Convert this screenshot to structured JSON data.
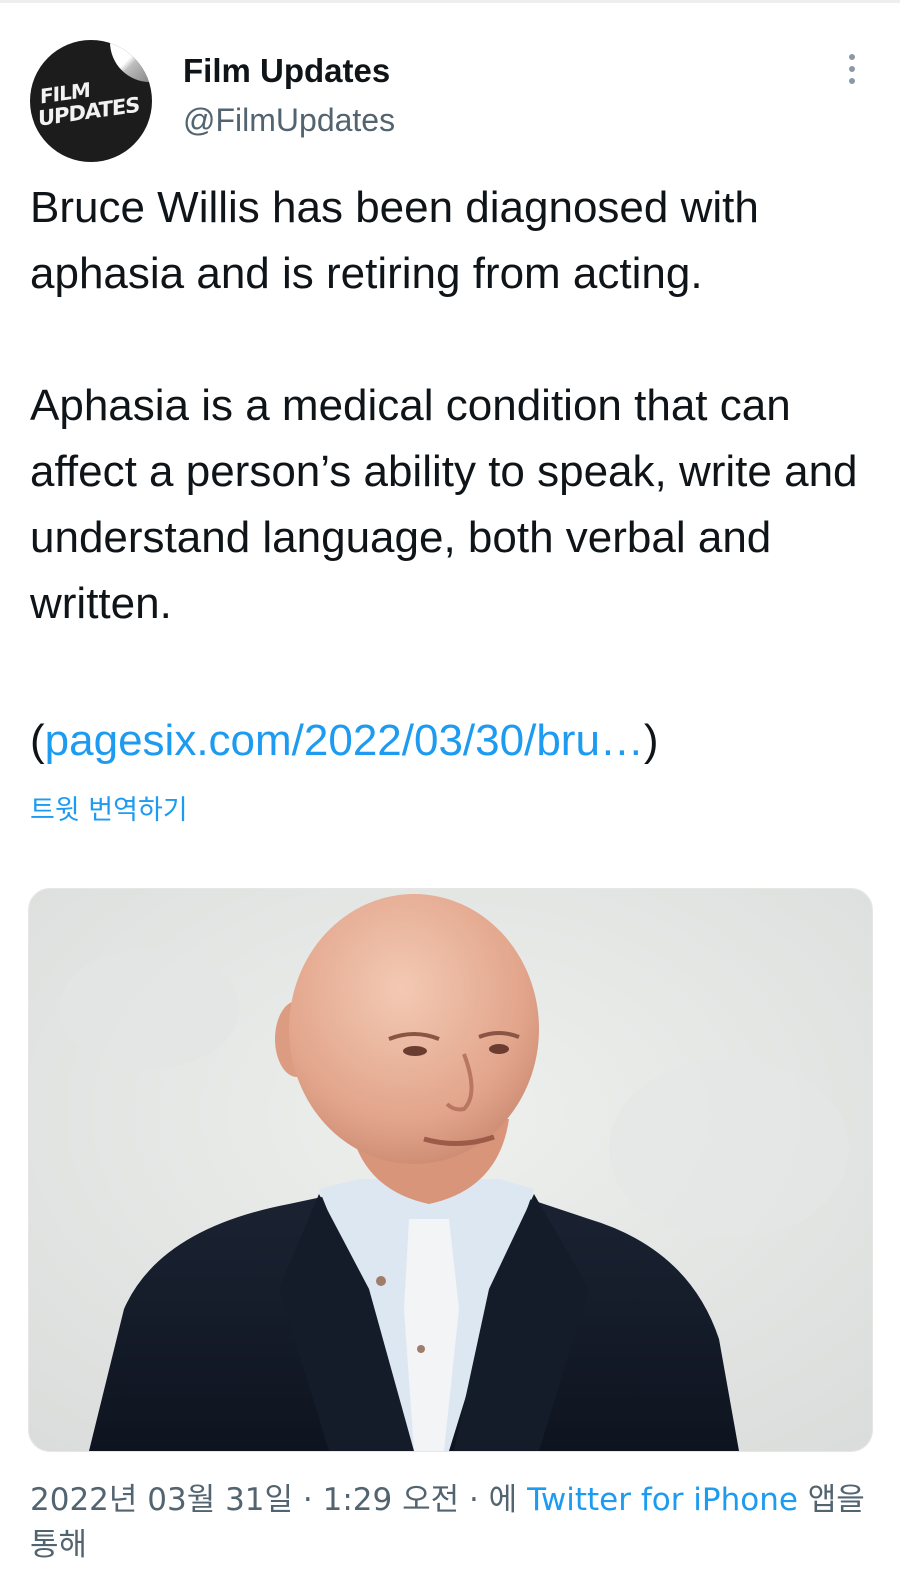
{
  "author": {
    "display_name": "Film Updates",
    "handle": "@FilmUpdates",
    "avatar_logo_line1": "FILM",
    "avatar_logo_line2": "UPDATES"
  },
  "tweet": {
    "paragraph1": "Bruce Willis has been diagnosed with aphasia and is retiring from acting.",
    "paragraph2": "Aphasia is a medical condition that can affect a person’s ability to speak, write and understand language, both verbal and written.",
    "link_open": "(",
    "link_text": "pagesix.com/2022/03/30/bru…",
    "link_close": ")",
    "translate_label": "트윗 번역하기"
  },
  "meta": {
    "timestamp_prefix": "2022년 03월 31일 · 1:29 오전 · 에 ",
    "source": "Twitter for iPhone",
    "timestamp_suffix": " 앱을 통해"
  },
  "colors": {
    "link": "#1d9bf0",
    "secondary_text": "#536471",
    "primary_text": "#0f1419"
  },
  "icons": {
    "more": "more-vertical-icon"
  }
}
